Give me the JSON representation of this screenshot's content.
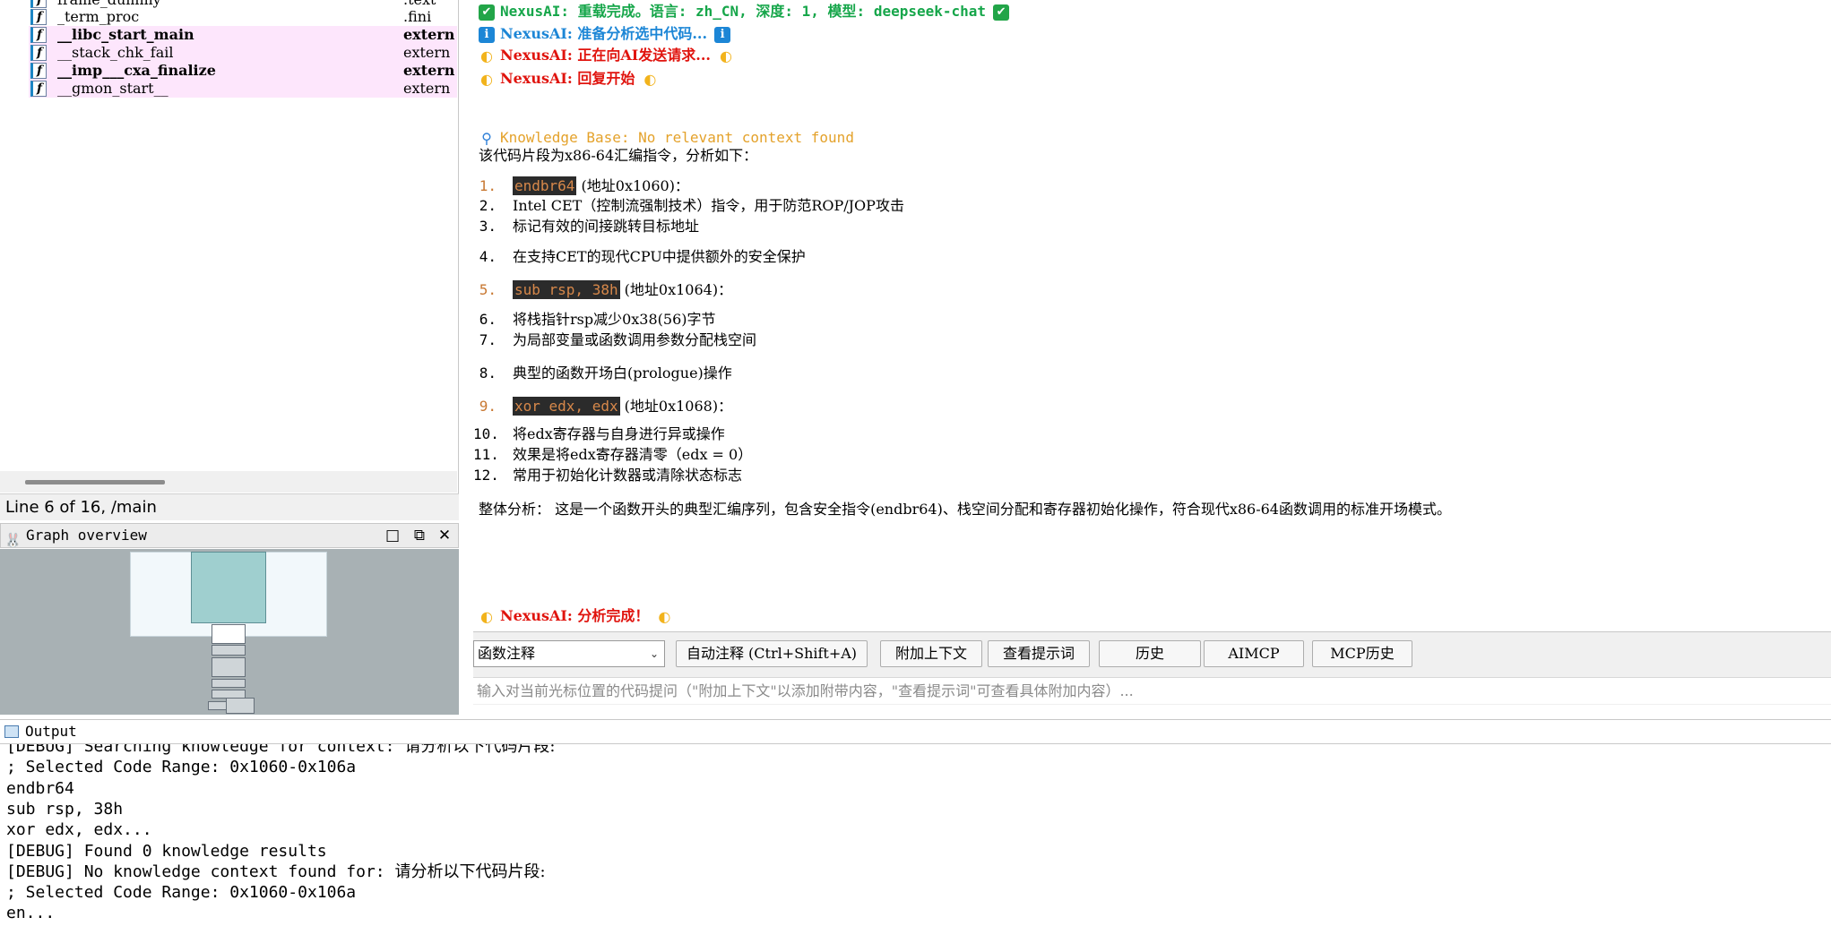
{
  "functions": [
    {
      "name": "frame_dummy",
      "segment": ".text",
      "bold": false,
      "highlight": false
    },
    {
      "name": "_term_proc",
      "segment": ".fini",
      "bold": false,
      "highlight": false
    },
    {
      "name": "__libc_start_main",
      "segment": "extern",
      "bold": true,
      "highlight": true
    },
    {
      "name": "__stack_chk_fail",
      "segment": "extern",
      "bold": false,
      "highlight": true
    },
    {
      "name": "__imp___cxa_finalize",
      "segment": "extern",
      "bold": true,
      "highlight": true
    },
    {
      "name": "__gmon_start__",
      "segment": "extern",
      "bold": false,
      "highlight": true
    }
  ],
  "status_line": "Line 6 of 16, /main",
  "graph_overview": {
    "title": "Graph overview"
  },
  "chat": {
    "msg_reload": "NexusAI: 重载完成。语言: zh_CN, 深度: 1, 模型: deepseek-chat",
    "msg_prepare": "NexusAI: 准备分析选中代码...",
    "msg_sending": "NexusAI: 正在向AI发送请求...",
    "msg_reply": "NexusAI: 回复开始",
    "kb_status": "Knowledge Base: No relevant context found",
    "intro": "该代码片段为x86-64汇编指令，分析如下：",
    "items": [
      {
        "num": "1.",
        "code": "endbr64",
        "text": " (地址0x1060)：",
        "accent": true
      },
      {
        "num": "2.",
        "code": "",
        "text": "Intel CET（控制流强制技术）指令，用于防范ROP/JOP攻击",
        "accent": false
      },
      {
        "num": "3.",
        "code": "",
        "text": "标记有效的间接跳转目标地址",
        "accent": false
      },
      {
        "num": "4.",
        "code": "",
        "text": "在支持CET的现代CPU中提供额外的安全保护",
        "accent": false
      },
      {
        "num": "5.",
        "code": "sub rsp, 38h",
        "text": " (地址0x1064)：",
        "accent": true
      },
      {
        "num": "6.",
        "code": "",
        "text": "将栈指针rsp减少0x38(56)字节",
        "accent": false
      },
      {
        "num": "7.",
        "code": "",
        "text": "为局部变量或函数调用参数分配栈空间",
        "accent": false
      },
      {
        "num": "8.",
        "code": "",
        "text": "典型的函数开场白(prologue)操作",
        "accent": false
      },
      {
        "num": "9.",
        "code": "xor edx, edx",
        "text": " (地址0x1068)：",
        "accent": true
      },
      {
        "num": "10.",
        "code": "",
        "text": "将edx寄存器与自身进行异或操作",
        "accent": false
      },
      {
        "num": "11.",
        "code": "",
        "text": "效果是将edx寄存器清零（edx = 0）",
        "accent": false
      },
      {
        "num": "12.",
        "code": "",
        "text": "常用于初始化计数器或清除状态标志",
        "accent": false
      }
    ],
    "summary": "整体分析： 这是一个函数开头的典型汇编序列，包含安全指令(endbr64)、栈空间分配和寄存器初始化操作，符合现代x86-64函数调用的标准开场模式。",
    "msg_done": "NexusAI: 分析完成！"
  },
  "toolbar": {
    "select_value": "函数注释",
    "auto_comment": "自动注释 (Ctrl+Shift+A)",
    "attach_context": "附加上下文",
    "view_prompt": "查看提示词",
    "history": "历史",
    "aimcp": "AIMCP",
    "mcp_history": "MCP历史",
    "input_placeholder": "输入对当前光标位置的代码提问（\"附加上下文\"以添加附带内容，\"查看提示词\"可查看具体附加内容）..."
  },
  "output": {
    "title": "Output",
    "lines": [
      {
        "en": "[DEBUG] Searching knowledge for context: ",
        "zh": "请分析以下代码片段:"
      },
      {
        "en": "; Selected Code Range: 0x1060-0x106a",
        "zh": ""
      },
      {
        "en": "endbr64",
        "zh": ""
      },
      {
        "en": "sub     rsp, 38h",
        "zh": ""
      },
      {
        "en": "xor     edx, edx...",
        "zh": ""
      },
      {
        "en": "[DEBUG] Found 0 knowledge results",
        "zh": ""
      },
      {
        "en": "[DEBUG] No knowledge context found for: ",
        "zh": "请分析以下代码片段:"
      },
      {
        "en": "; Selected Code Range: 0x1060-0x106a",
        "zh": ""
      },
      {
        "en": "en...",
        "zh": ""
      }
    ]
  },
  "colors": {
    "green": "#16a64a",
    "blue": "#1c86d6",
    "red": "#e0140e",
    "orange": "#e4a22b",
    "code_bg": "#2b2b2b",
    "code_fg": "#d7884a",
    "highlight_row": "#fde6fc"
  }
}
